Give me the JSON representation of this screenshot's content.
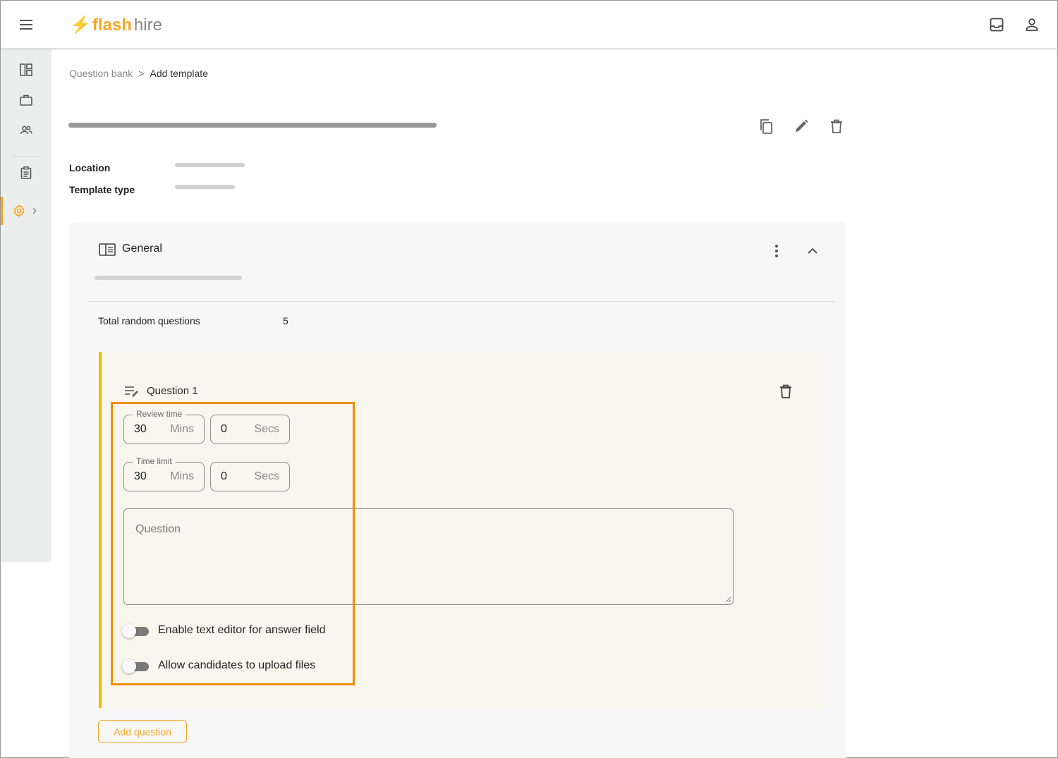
{
  "colors": {
    "brand": "#f5a623",
    "highlight": "#f28c00",
    "question_accent": "#f5b800"
  },
  "header": {
    "logo_mark": "⚡",
    "logo_bold": "flash",
    "logo_light": "hire",
    "icons": [
      "menu-icon",
      "inbox-icon",
      "user-account-icon"
    ]
  },
  "sidebar": {
    "items": [
      {
        "name": "dashboard-icon"
      },
      {
        "name": "jobs-briefcase-icon"
      },
      {
        "name": "candidates-people-icon"
      },
      {
        "name": "clipboard-icon"
      },
      {
        "name": "settings-gear-icon",
        "active": true,
        "expand": "chevron-right-icon"
      }
    ]
  },
  "breadcrumb": {
    "parent": "Question bank",
    "separator": ">",
    "current": "Add template"
  },
  "details": {
    "location_label": "Location",
    "template_type_label": "Template type"
  },
  "section": {
    "title": "General",
    "total_random_questions_label": "Total random questions",
    "total_random_questions_value": "5"
  },
  "question": {
    "title": "Question 1",
    "review_time": {
      "legend": "Review time",
      "mins_value": "30",
      "mins_unit": "Mins",
      "secs_value": "0",
      "secs_unit": "Secs"
    },
    "time_limit": {
      "legend": "Time limit",
      "mins_value": "30",
      "mins_unit": "Mins",
      "secs_value": "0",
      "secs_unit": "Secs"
    },
    "question_placeholder": "Question",
    "toggle_text_editor": {
      "label": "Enable text editor for answer field",
      "on": false
    },
    "toggle_upload_files": {
      "label": "Allow candidates to upload files",
      "on": false
    }
  },
  "actions": {
    "add_question": "Add question"
  }
}
